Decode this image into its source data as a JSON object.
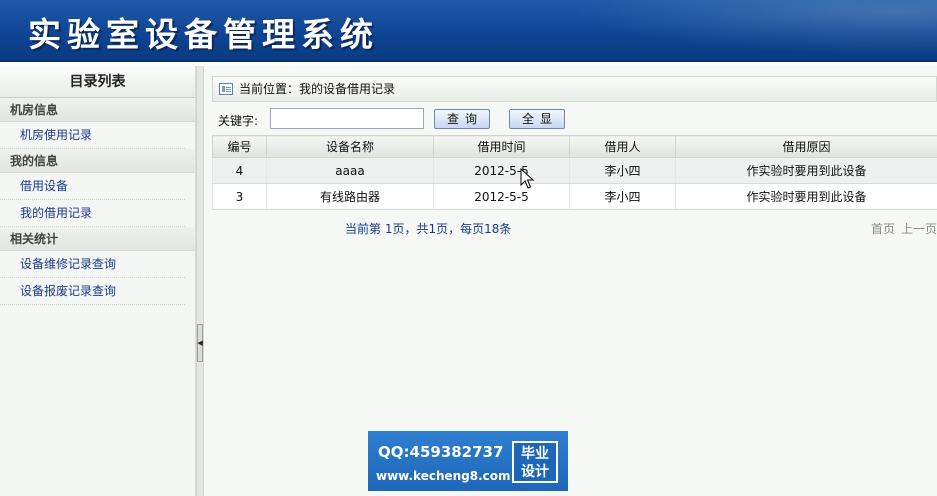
{
  "header": {
    "title": "实验室设备管理系统"
  },
  "sidebar": {
    "title": "目录列表",
    "groups": [
      {
        "title": "机房信息",
        "items": [
          {
            "label": "机房使用记录"
          }
        ]
      },
      {
        "title": "我的信息",
        "items": [
          {
            "label": "借用设备"
          },
          {
            "label": "我的借用记录"
          }
        ]
      },
      {
        "title": "相关统计",
        "items": [
          {
            "label": "设备维修记录查询"
          },
          {
            "label": "设备报废记录查询"
          }
        ]
      }
    ]
  },
  "breadcrumb": {
    "text": "当前位置：我的设备借用记录"
  },
  "search": {
    "label": "关键字:",
    "value": "",
    "placeholder": "",
    "query_button": "查询",
    "show_all_button": "全显"
  },
  "table": {
    "columns": [
      "编号",
      "设备名称",
      "借用时间",
      "借用人",
      "借用原因"
    ],
    "rows": [
      [
        "4",
        "aaaa",
        "2012-5-5",
        "李小四",
        "作实验时要用到此设备"
      ],
      [
        "3",
        "有线路由器",
        "2012-5-5",
        "李小四",
        "作实验时要用到此设备"
      ]
    ]
  },
  "pager": {
    "info": "当前第 1页，共1页，每页18条",
    "first": "首页",
    "prev": "上一页"
  },
  "watermark": {
    "qq": "QQ:459382737",
    "site": "www.kecheng8.com",
    "badge_line1": "毕业",
    "badge_line2": "设计"
  },
  "colors": {
    "banner": "#0f4594",
    "link": "#1a3a8a",
    "watermark": "#1e66b8"
  }
}
